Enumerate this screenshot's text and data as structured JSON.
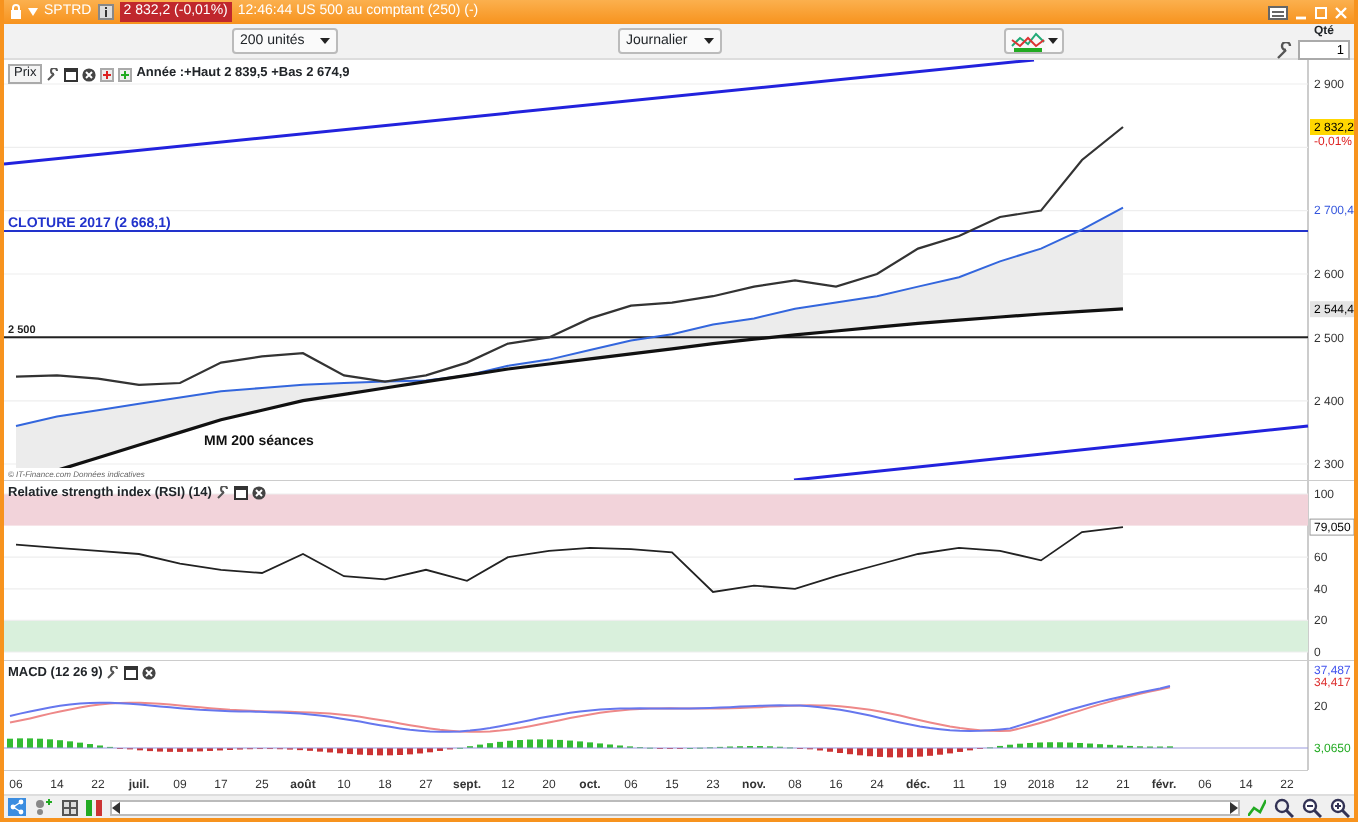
{
  "window": {
    "symbol": "SPTRD",
    "quote": "2 832,2 (-0,01%)",
    "info": "12:46:44 US 500 au comptant (250) (-)"
  },
  "toolbar": {
    "period_count": "200 unités",
    "interval": "Journalier",
    "quantity_label": "Qté",
    "quantity": "1"
  },
  "price_panel": {
    "title": "Prix",
    "summary": "Année :+Haut 2 839,5 +Bas 2 674,9",
    "close_label": "CLOTURE 2017 (2 668,1)",
    "level_label": "2 500",
    "ma200_label": "MM 200 séances",
    "copyright": "© IT-Finance.com  Données indicatives",
    "axis_labels": [
      {
        "text": "2 900",
        "kind": "tick"
      },
      {
        "text": "2 832,2",
        "kind": "last"
      },
      {
        "text": "-0,01%",
        "kind": "change"
      },
      {
        "text": "2 700,4",
        "kind": "ma"
      },
      {
        "text": "2 600",
        "kind": "tick"
      },
      {
        "text": "2 544,4",
        "kind": "ma200"
      },
      {
        "text": "2 500",
        "kind": "tick"
      },
      {
        "text": "2 400",
        "kind": "tick"
      },
      {
        "text": "2 300",
        "kind": "tick"
      }
    ]
  },
  "rsi_panel": {
    "title": "Relative strength index (RSI) (14)",
    "axis_labels": [
      {
        "text": "100",
        "kind": "tick"
      },
      {
        "text": "79,050",
        "kind": "last"
      },
      {
        "text": "60",
        "kind": "tick"
      },
      {
        "text": "40",
        "kind": "tick"
      },
      {
        "text": "20",
        "kind": "tick"
      },
      {
        "text": "0",
        "kind": "tick"
      }
    ]
  },
  "macd_panel": {
    "title": "MACD (12 26 9)",
    "readings": [
      {
        "label": "37,487",
        "color": "#4455ee"
      },
      {
        "label": "34,417",
        "color": "#dd3333"
      },
      {
        "label": "20",
        "color": "#333333"
      },
      {
        "label": "3,0650",
        "color": "#22aa22"
      }
    ]
  },
  "date_axis": [
    "06",
    "14",
    "22",
    "juil.",
    "09",
    "17",
    "25",
    "août",
    "10",
    "18",
    "27",
    "sept.",
    "12",
    "20",
    "oct.",
    "06",
    "15",
    "23",
    "nov.",
    "08",
    "16",
    "24",
    "déc.",
    "11",
    "19",
    "2018",
    "12",
    "21",
    "févr.",
    "06",
    "14",
    "22"
  ]
}
